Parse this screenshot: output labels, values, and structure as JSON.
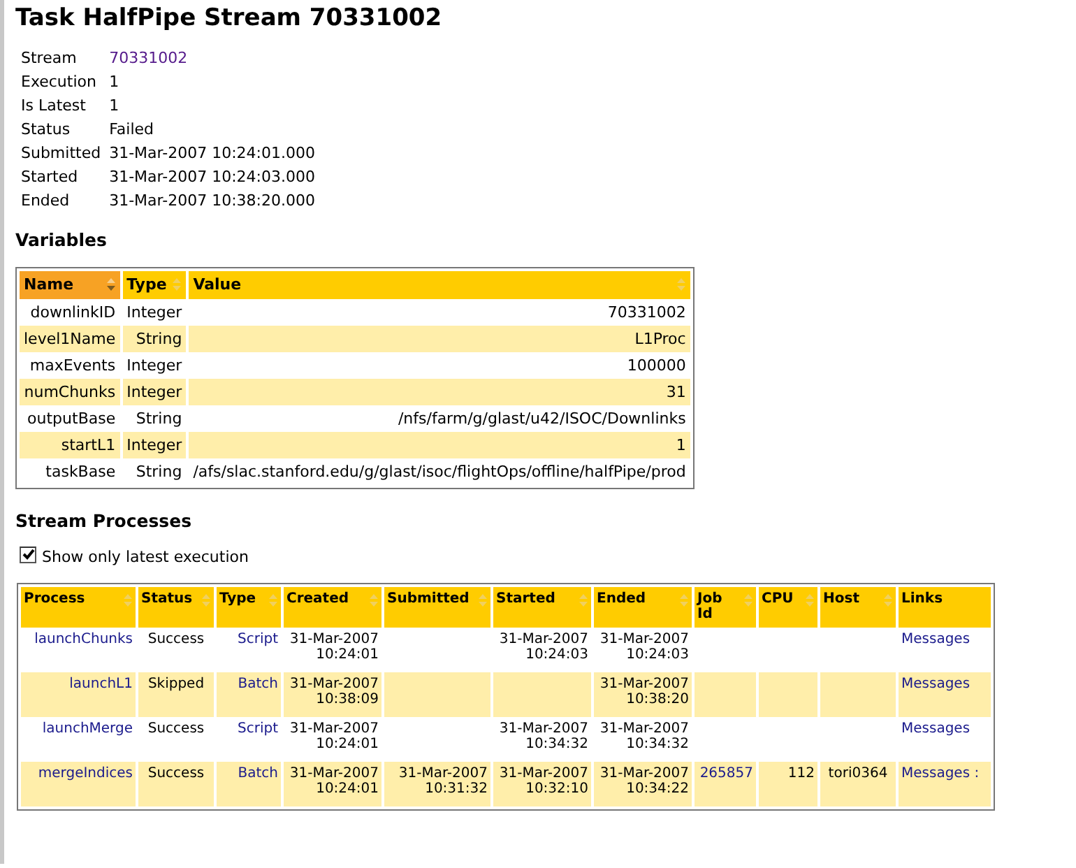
{
  "page_title": "Task HalfPipe Stream 70331002",
  "summary": [
    {
      "label": "Stream",
      "value": "70331002",
      "kind": "link"
    },
    {
      "label": "Execution",
      "value": "1",
      "kind": "text"
    },
    {
      "label": "Is Latest",
      "value": "1",
      "kind": "text"
    },
    {
      "label": "Status",
      "value": "Failed",
      "kind": "text"
    },
    {
      "label": "Submitted",
      "value": "31-Mar-2007 10:24:01.000",
      "kind": "text"
    },
    {
      "label": "Started",
      "value": "31-Mar-2007 10:24:03.000",
      "kind": "text"
    },
    {
      "label": "Ended",
      "value": "31-Mar-2007 10:38:20.000",
      "kind": "text"
    }
  ],
  "variables": {
    "heading": "Variables",
    "columns": [
      {
        "label": "Name",
        "sorted": true
      },
      {
        "label": "Type",
        "sorted": false
      },
      {
        "label": "Value",
        "sorted": false
      }
    ],
    "rows": [
      {
        "name": "downlinkID",
        "type": "Integer",
        "value": "70331002"
      },
      {
        "name": "level1Name",
        "type": "String",
        "value": "L1Proc"
      },
      {
        "name": "maxEvents",
        "type": "Integer",
        "value": "100000"
      },
      {
        "name": "numChunks",
        "type": "Integer",
        "value": "31"
      },
      {
        "name": "outputBase",
        "type": "String",
        "value": "/nfs/farm/g/glast/u42/ISOC/Downlinks"
      },
      {
        "name": "startL1",
        "type": "Integer",
        "value": "1"
      },
      {
        "name": "taskBase",
        "type": "String",
        "value": "/afs/slac.stanford.edu/g/glast/isoc/flightOps/offline/halfPipe/prod"
      }
    ]
  },
  "processes": {
    "heading": "Stream Processes",
    "latest_only": {
      "label": "Show only latest execution",
      "checked": true
    },
    "columns": [
      {
        "label": "Process",
        "sortable": true
      },
      {
        "label": "Status",
        "sortable": true
      },
      {
        "label": "Type",
        "sortable": true
      },
      {
        "label": "Created",
        "sortable": true
      },
      {
        "label": "Submitted",
        "sortable": true
      },
      {
        "label": "Started",
        "sortable": true
      },
      {
        "label": "Ended",
        "sortable": true
      },
      {
        "label": "Job Id",
        "sortable": true
      },
      {
        "label": "CPU",
        "sortable": true
      },
      {
        "label": "Host",
        "sortable": true
      },
      {
        "label": "Links",
        "sortable": false
      }
    ],
    "rows": [
      {
        "process": "launchChunks",
        "status": "Success",
        "type": "Script",
        "created": "31-Mar-2007 10:24:01",
        "started": "31-Mar-2007 10:24:03",
        "ended": "31-Mar-2007 10:24:03",
        "links": "Messages"
      },
      {
        "process": "launchL1",
        "status": "Skipped",
        "type": "Batch",
        "created": "31-Mar-2007 10:38:09",
        "ended": "31-Mar-2007 10:38:20",
        "links": "Messages"
      },
      {
        "process": "launchMerge",
        "status": "Success",
        "type": "Script",
        "created": "31-Mar-2007 10:24:01",
        "started": "31-Mar-2007 10:34:32",
        "ended": "31-Mar-2007 10:34:32",
        "links": "Messages"
      },
      {
        "process": "mergeIndices",
        "status": "Success",
        "type": "Batch",
        "created": "31-Mar-2007 10:24:01",
        "submitted": "31-Mar-2007 10:31:32",
        "started": "31-Mar-2007 10:32:10",
        "ended": "31-Mar-2007 10:34:22",
        "job_id": "265857",
        "cpu": "112",
        "host": "tori0364",
        "links": "Messages :"
      }
    ]
  }
}
